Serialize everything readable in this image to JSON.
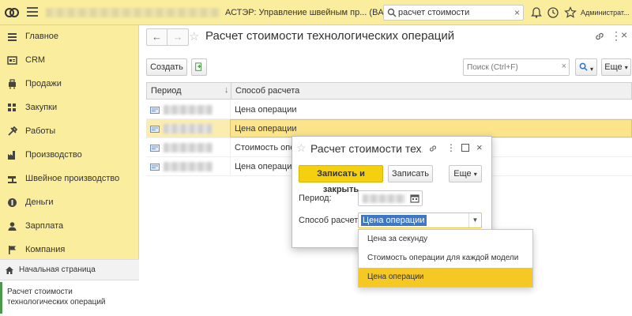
{
  "titlebar": {
    "app_title": "АСТЭР: Управление швейным пр...  (BAF)",
    "search_value": "расчет стоимости",
    "user_name": "Администрат..."
  },
  "sidebar": {
    "items": [
      {
        "label": "Главное",
        "icon": "menu-lines-icon"
      },
      {
        "label": "CRM",
        "icon": "crm-card-icon"
      },
      {
        "label": "Продажи",
        "icon": "cart-icon"
      },
      {
        "label": "Закупки",
        "icon": "purchase-grid-icon"
      },
      {
        "label": "Работы",
        "icon": "tools-icon"
      },
      {
        "label": "Производство",
        "icon": "factory-icon"
      },
      {
        "label": "Швейное производство",
        "icon": "sewing-machine-icon"
      },
      {
        "label": "Деньги",
        "icon": "coin-icon"
      },
      {
        "label": "Зарплата",
        "icon": "person-icon"
      },
      {
        "label": "Компания",
        "icon": "flag-icon"
      }
    ],
    "home_label": "Начальная страница",
    "open_page_label": "Расчет стоимости технологических операций"
  },
  "main": {
    "page_title": "Расчет стоимости технологических операций",
    "create_label": "Создать",
    "search_placeholder": "Поиск (Ctrl+F)",
    "more_label": "Еще",
    "columns": [
      "Период",
      "Способ расчета"
    ],
    "sort_arrow": "↓",
    "rows": [
      {
        "method": "Цена операции",
        "selected": false
      },
      {
        "method": "Цена операции",
        "selected": true
      },
      {
        "method": "Стоимость опера",
        "selected": false
      },
      {
        "method": "Цена операции",
        "selected": false
      }
    ]
  },
  "modal": {
    "title": "Расчет стоимости тех...",
    "save_close_label": "Записать и закрыть",
    "save_label": "Записать",
    "more_label": "Еще",
    "period_label": "Период:",
    "method_label": "Способ расчета:",
    "method_value": "Цена операции"
  },
  "dropdown": {
    "options": [
      "Цена за секунду",
      "Стоимость операции для каждой модели",
      "Цена операции"
    ],
    "active_index": 2
  },
  "colors": {
    "accent_yellow": "#fbed9e",
    "primary_button": "#f5d00f",
    "selection_blue": "#3c78c6"
  }
}
